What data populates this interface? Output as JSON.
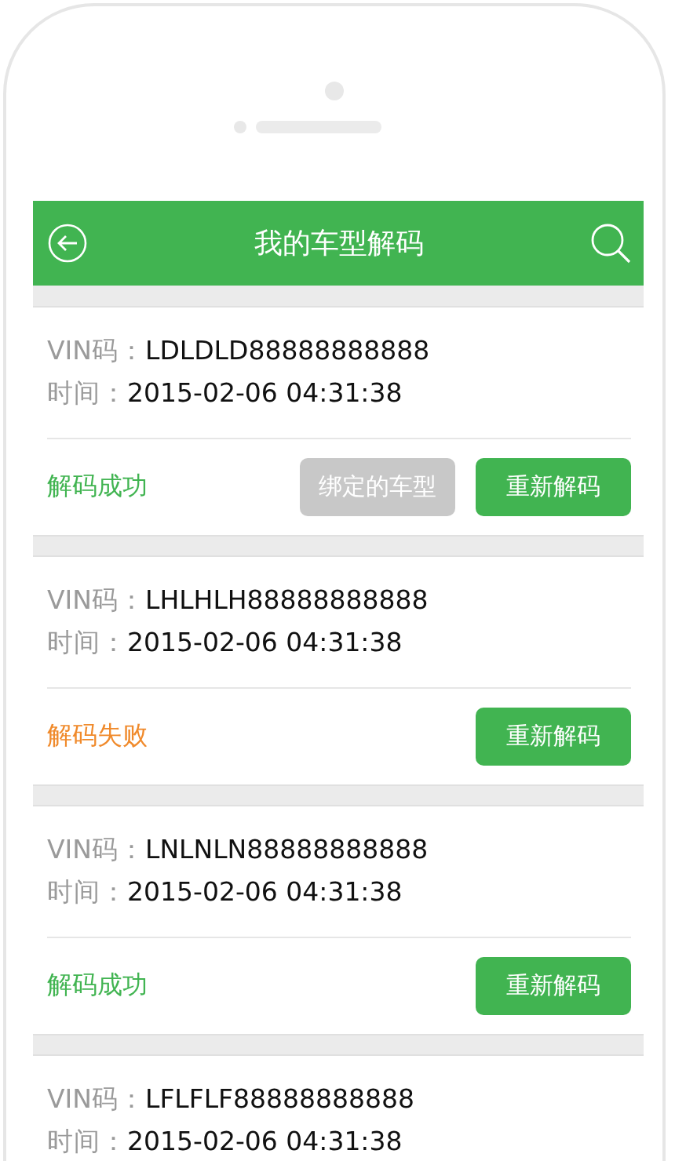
{
  "header": {
    "title": "我的车型解码"
  },
  "records": [
    {
      "vin_label": "VIN码：",
      "vin": "LDLDLD88888888888",
      "time_label": "时间：",
      "time": "2015-02-06 04:31:38",
      "status": {
        "text": "解码成功",
        "kind": "success"
      },
      "buttons": [
        {
          "label": "绑定的车型",
          "kind": "bound"
        },
        {
          "label": "重新解码",
          "kind": "redecode"
        }
      ]
    },
    {
      "vin_label": "VIN码：",
      "vin": "LHLHLH88888888888",
      "time_label": "时间：",
      "time": "2015-02-06 04:31:38",
      "status": {
        "text": "解码失败",
        "kind": "failure"
      },
      "buttons": [
        {
          "label": "重新解码",
          "kind": "redecode"
        }
      ]
    },
    {
      "vin_label": "VIN码：",
      "vin": "LNLNLN88888888888",
      "time_label": "时间：",
      "time": "2015-02-06 04:31:38",
      "status": {
        "text": "解码成功",
        "kind": "success"
      },
      "buttons": [
        {
          "label": "重新解码",
          "kind": "redecode"
        }
      ]
    },
    {
      "vin_label": "VIN码：",
      "vin": "LFLFLF88888888888",
      "time_label": "时间：",
      "time": "2015-02-06 04:31:38"
    }
  ]
}
